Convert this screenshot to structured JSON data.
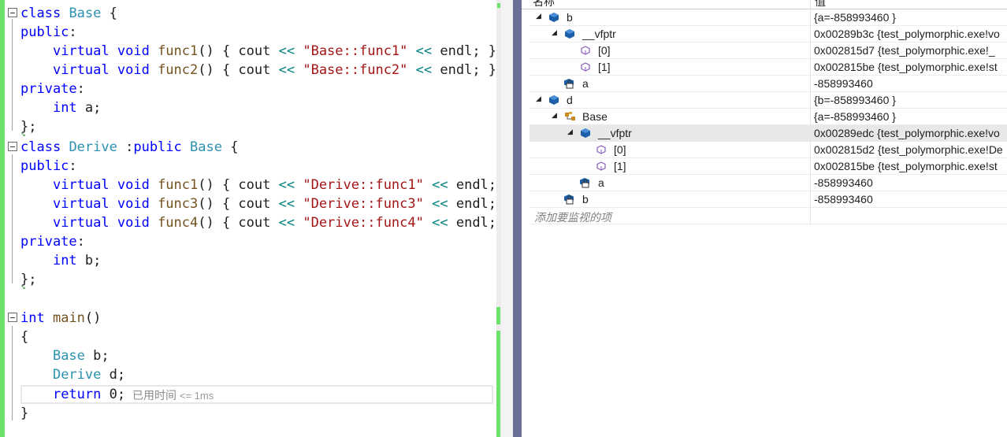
{
  "editor": {
    "lines": [
      [
        [
          "kw",
          "class"
        ],
        [
          "pl",
          " "
        ],
        [
          "ty",
          "Base"
        ],
        [
          "pl",
          " {"
        ]
      ],
      [
        [
          "kw",
          "public"
        ],
        [
          "pl",
          ":"
        ]
      ],
      [
        [
          "pl",
          "    "
        ],
        [
          "kw",
          "virtual"
        ],
        [
          "pl",
          " "
        ],
        [
          "kw",
          "void"
        ],
        [
          "pl",
          " "
        ],
        [
          "fn",
          "func1"
        ],
        [
          "pl",
          "() { cout "
        ],
        [
          "op",
          "<<"
        ],
        [
          "pl",
          " "
        ],
        [
          "st",
          "\"Base::func1\""
        ],
        [
          "pl",
          " "
        ],
        [
          "op",
          "<<"
        ],
        [
          "pl",
          " endl; }"
        ]
      ],
      [
        [
          "pl",
          "    "
        ],
        [
          "kw",
          "virtual"
        ],
        [
          "pl",
          " "
        ],
        [
          "kw",
          "void"
        ],
        [
          "pl",
          " "
        ],
        [
          "fn",
          "func2"
        ],
        [
          "pl",
          "() { cout "
        ],
        [
          "op",
          "<<"
        ],
        [
          "pl",
          " "
        ],
        [
          "st",
          "\"Base::func2\""
        ],
        [
          "pl",
          " "
        ],
        [
          "op",
          "<<"
        ],
        [
          "pl",
          " endl; }"
        ]
      ],
      [
        [
          "kw",
          "private"
        ],
        [
          "pl",
          ":"
        ]
      ],
      [
        [
          "pl",
          "    "
        ],
        [
          "kw",
          "int"
        ],
        [
          "pl",
          " a;"
        ]
      ],
      [
        [
          "pl",
          "};"
        ]
      ],
      [
        [
          "kw",
          "class"
        ],
        [
          "pl",
          " "
        ],
        [
          "ty",
          "Derive"
        ],
        [
          "pl",
          " :"
        ],
        [
          "kw",
          "public"
        ],
        [
          "pl",
          " "
        ],
        [
          "ty",
          "Base"
        ],
        [
          "pl",
          " {"
        ]
      ],
      [
        [
          "kw",
          "public"
        ],
        [
          "pl",
          ":"
        ]
      ],
      [
        [
          "pl",
          "    "
        ],
        [
          "kw",
          "virtual"
        ],
        [
          "pl",
          " "
        ],
        [
          "kw",
          "void"
        ],
        [
          "pl",
          " "
        ],
        [
          "fn",
          "func1"
        ],
        [
          "pl",
          "() { cout "
        ],
        [
          "op",
          "<<"
        ],
        [
          "pl",
          " "
        ],
        [
          "st",
          "\"Derive::func1\""
        ],
        [
          "pl",
          " "
        ],
        [
          "op",
          "<<"
        ],
        [
          "pl",
          " endl; }"
        ]
      ],
      [
        [
          "pl",
          "    "
        ],
        [
          "kw",
          "virtual"
        ],
        [
          "pl",
          " "
        ],
        [
          "kw",
          "void"
        ],
        [
          "pl",
          " "
        ],
        [
          "fn",
          "func3"
        ],
        [
          "pl",
          "() { cout "
        ],
        [
          "op",
          "<<"
        ],
        [
          "pl",
          " "
        ],
        [
          "st",
          "\"Derive::func3\""
        ],
        [
          "pl",
          " "
        ],
        [
          "op",
          "<<"
        ],
        [
          "pl",
          " endl; }"
        ]
      ],
      [
        [
          "pl",
          "    "
        ],
        [
          "kw",
          "virtual"
        ],
        [
          "pl",
          " "
        ],
        [
          "kw",
          "void"
        ],
        [
          "pl",
          " "
        ],
        [
          "fn",
          "func4"
        ],
        [
          "pl",
          "() { cout "
        ],
        [
          "op",
          "<<"
        ],
        [
          "pl",
          " "
        ],
        [
          "st",
          "\"Derive::func4\""
        ],
        [
          "pl",
          " "
        ],
        [
          "op",
          "<<"
        ],
        [
          "pl",
          " endl; }"
        ]
      ],
      [
        [
          "kw",
          "private"
        ],
        [
          "pl",
          ":"
        ]
      ],
      [
        [
          "pl",
          "    "
        ],
        [
          "kw",
          "int"
        ],
        [
          "pl",
          " b;"
        ]
      ],
      [
        [
          "pl",
          "};"
        ]
      ],
      [
        [
          "pl",
          ""
        ]
      ],
      [
        [
          "kw",
          "int"
        ],
        [
          "pl",
          " "
        ],
        [
          "fn",
          "main"
        ],
        [
          "pl",
          "()"
        ]
      ],
      [
        [
          "pl",
          "{"
        ]
      ],
      [
        [
          "pl",
          "    "
        ],
        [
          "ty",
          "Base"
        ],
        [
          "pl",
          " b;"
        ]
      ],
      [
        [
          "pl",
          "    "
        ],
        [
          "ty",
          "Derive"
        ],
        [
          "pl",
          " d;"
        ]
      ],
      [
        [
          "pl",
          "    "
        ],
        [
          "kw",
          "return"
        ],
        [
          "pl",
          " 0;"
        ]
      ],
      [
        [
          "pl",
          "}"
        ]
      ]
    ],
    "elapsed_label": "已用时间",
    "elapsed_value": "<= 1ms"
  },
  "watch": {
    "header_name": "名称",
    "header_value": "值",
    "rows": [
      {
        "name": "b",
        "value": "{a=-858993460 }",
        "expander": "expanded",
        "icon": "object-icon"
      },
      {
        "name": "__vfptr",
        "value": "0x00289b3c {test_polymorphic.exe!vo",
        "expander": "expanded",
        "icon": "object-icon"
      },
      {
        "name": "[0]",
        "value": "0x002815d7 {test_polymorphic.exe!_",
        "expander": "none",
        "icon": "method-icon"
      },
      {
        "name": "[1]",
        "value": "0x002815be {test_polymorphic.exe!st",
        "expander": "none",
        "icon": "method-icon"
      },
      {
        "name": "a",
        "value": "-858993460",
        "expander": "none",
        "icon": "private-field-icon"
      },
      {
        "name": "d",
        "value": "{b=-858993460 }",
        "expander": "expanded",
        "icon": "object-icon"
      },
      {
        "name": "Base",
        "value": "{a=-858993460 }",
        "expander": "expanded",
        "icon": "base-class-icon"
      },
      {
        "name": "__vfptr",
        "value": "0x00289edc {test_polymorphic.exe!vo",
        "expander": "expanded",
        "icon": "object-icon"
      },
      {
        "name": "[0]",
        "value": "0x002815d2 {test_polymorphic.exe!De",
        "expander": "none",
        "icon": "method-icon"
      },
      {
        "name": "[1]",
        "value": "0x002815be {test_polymorphic.exe!st",
        "expander": "none",
        "icon": "method-icon"
      },
      {
        "name": "a",
        "value": "-858993460",
        "expander": "none",
        "icon": "private-field-icon"
      },
      {
        "name": "b",
        "value": "-858993460",
        "expander": "none",
        "icon": "private-field-icon"
      }
    ],
    "add_watch": "添加要监视的项"
  }
}
